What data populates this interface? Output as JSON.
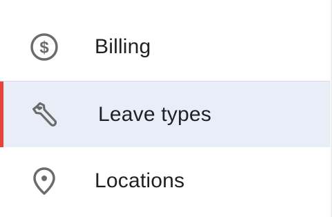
{
  "sidebar": {
    "items": [
      {
        "label": "Billing",
        "icon": "dollar-circle-icon",
        "active": false
      },
      {
        "label": "Leave types",
        "icon": "wrench-icon",
        "active": true
      },
      {
        "label": "Locations",
        "icon": "location-pin-icon",
        "active": false
      }
    ],
    "colors": {
      "active_background": "#e8edf8",
      "active_indicator": "#e8433a",
      "icon": "#6b6b6b",
      "text": "#202124"
    }
  }
}
